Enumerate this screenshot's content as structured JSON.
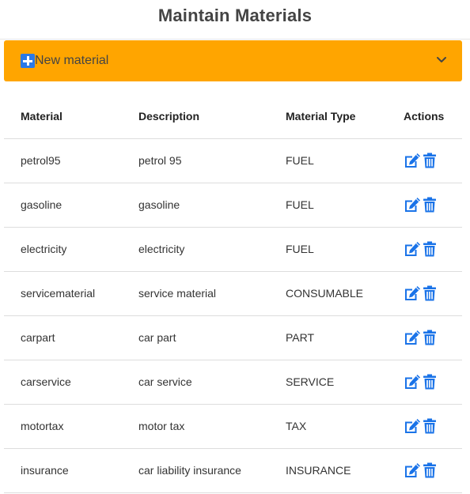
{
  "page": {
    "title": "Maintain Materials"
  },
  "accordion": {
    "label": "New material",
    "icon": "plus-square-icon",
    "toggle_icon": "chevron-down-icon",
    "background": "#ffa500"
  },
  "table": {
    "headers": {
      "material": "Material",
      "description": "Description",
      "type": "Material Type",
      "actions": "Actions"
    },
    "rows": [
      {
        "material": "petrol95",
        "description": "petrol 95",
        "type": "FUEL"
      },
      {
        "material": "gasoline",
        "description": "gasoline",
        "type": "FUEL"
      },
      {
        "material": "electricity",
        "description": "electricity",
        "type": "FUEL"
      },
      {
        "material": "servicematerial",
        "description": "service material",
        "type": "CONSUMABLE"
      },
      {
        "material": "carpart",
        "description": "car part",
        "type": "PART"
      },
      {
        "material": "carservice",
        "description": "car service",
        "type": "SERVICE"
      },
      {
        "material": "motortax",
        "description": "motor tax",
        "type": "TAX"
      },
      {
        "material": "insurance",
        "description": "car liability insurance",
        "type": "INSURANCE"
      }
    ],
    "action_icons": {
      "edit": "edit-icon",
      "delete": "trash-icon"
    },
    "action_color": "#1a73e8"
  }
}
